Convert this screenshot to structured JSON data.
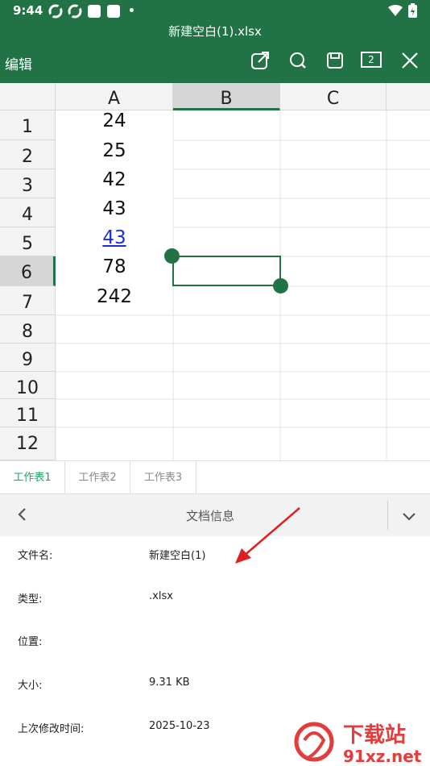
{
  "status_bar": {
    "time": "9:44"
  },
  "window": {
    "title": "新建空白(1).xlsx"
  },
  "toolbar": {
    "edit_label": "编辑",
    "sheet_count": "2"
  },
  "columns": [
    "A",
    "B",
    "C"
  ],
  "rows": [
    "1",
    "2",
    "3",
    "4",
    "5",
    "6",
    "7",
    "8",
    "9",
    "10",
    "11",
    "12"
  ],
  "column_a_values": [
    "24",
    "25",
    "42",
    "43",
    "43",
    "78",
    "242"
  ],
  "selected": {
    "column": "B",
    "row": "6"
  },
  "sheet_tabs": [
    "工作表1",
    "工作表2",
    "工作表3"
  ],
  "info_panel": {
    "title": "文档信息",
    "fields": [
      {
        "label": "文件名:",
        "value": "新建空白(1)"
      },
      {
        "label": "类型:",
        "value": ".xlsx"
      },
      {
        "label": "位置:",
        "value": ""
      },
      {
        "label": "大小:",
        "value": "9.31 KB"
      },
      {
        "label": "上次修改时间:",
        "value": "2025-10-23"
      }
    ]
  },
  "watermark": {
    "cn_text": "下载站",
    "en_text": "91xz.net"
  },
  "colors": {
    "brand_green": "#217346",
    "annotation_red": "#e02020"
  }
}
